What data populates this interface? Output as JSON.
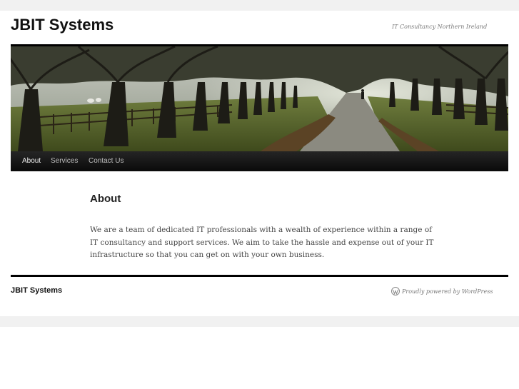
{
  "site": {
    "title": "JBIT Systems",
    "tagline": "IT Consultancy Northern Ireland"
  },
  "header_image": {
    "description": "tree-lined avenue with fence and path"
  },
  "nav": {
    "items": [
      {
        "label": "About",
        "active": true
      },
      {
        "label": "Services",
        "active": false
      },
      {
        "label": "Contact Us",
        "active": false
      }
    ]
  },
  "page": {
    "title": "About",
    "content": "We are a team of dedicated IT professionals with a wealth of experience within a range of IT consultancy and support services. We aim to take the hassle and expense out of your IT infrastructure so that you can get on with your own business."
  },
  "footer": {
    "site_name": "JBIT Systems",
    "powered_by": "Proudly powered by WordPress",
    "icon": "wordpress-icon"
  },
  "colors": {
    "nav_background": "#111111",
    "rule": "#000000",
    "band": "#f1f1f1"
  }
}
